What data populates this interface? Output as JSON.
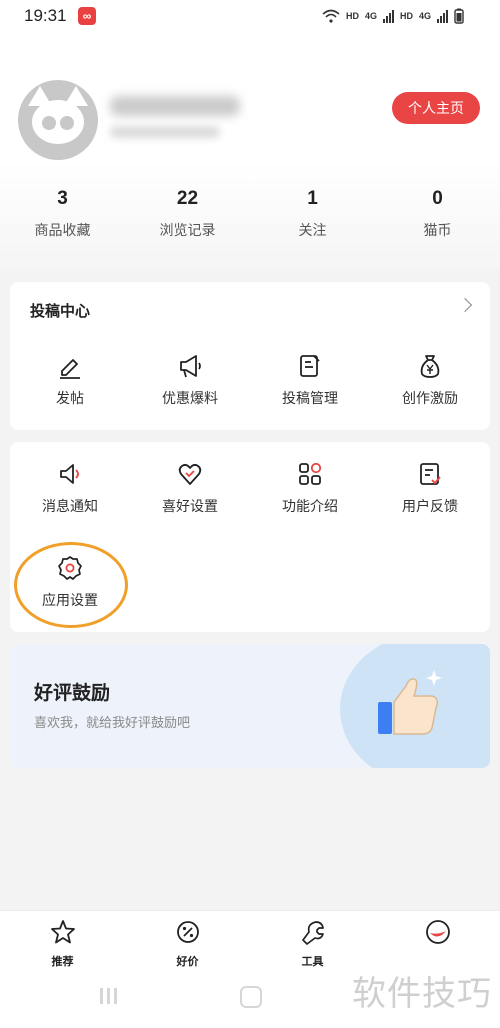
{
  "status_bar": {
    "time": "19:31",
    "app_icon": "app-icon",
    "indicators": [
      "HD",
      "4G",
      "HD",
      "4G"
    ]
  },
  "profile": {
    "homepage_button": "个人主页"
  },
  "stats": [
    {
      "value": "3",
      "label": "商品收藏"
    },
    {
      "value": "22",
      "label": "浏览记录"
    },
    {
      "value": "1",
      "label": "关注"
    },
    {
      "value": "0",
      "label": "猫币"
    }
  ],
  "submission_center": {
    "title": "投稿中心",
    "items": [
      {
        "label": "发帖",
        "icon": "pen-icon"
      },
      {
        "label": "优惠爆料",
        "icon": "megaphone-icon"
      },
      {
        "label": "投稿管理",
        "icon": "edit-doc-icon"
      },
      {
        "label": "创作激励",
        "icon": "money-bag-icon"
      }
    ]
  },
  "services": {
    "items": [
      {
        "label": "消息通知",
        "icon": "speaker-icon"
      },
      {
        "label": "喜好设置",
        "icon": "heart-icon"
      },
      {
        "label": "功能介绍",
        "icon": "grid-icon"
      },
      {
        "label": "用户反馈",
        "icon": "feedback-icon"
      },
      {
        "label": "应用设置",
        "icon": "gear-icon"
      }
    ]
  },
  "rate_banner": {
    "title": "好评鼓励",
    "subtitle": "喜欢我，就给我好评鼓励吧"
  },
  "bottom_nav": [
    {
      "label": "推荐",
      "icon": "star-icon"
    },
    {
      "label": "好价",
      "icon": "discount-icon"
    },
    {
      "label": "工具",
      "icon": "wrench-icon"
    },
    {
      "label": "",
      "icon": "profile-icon"
    }
  ],
  "watermark": "软件技巧",
  "colors": {
    "accent": "#e94545",
    "highlight": "#f0a029",
    "banner_bg": "#edf2fb"
  }
}
